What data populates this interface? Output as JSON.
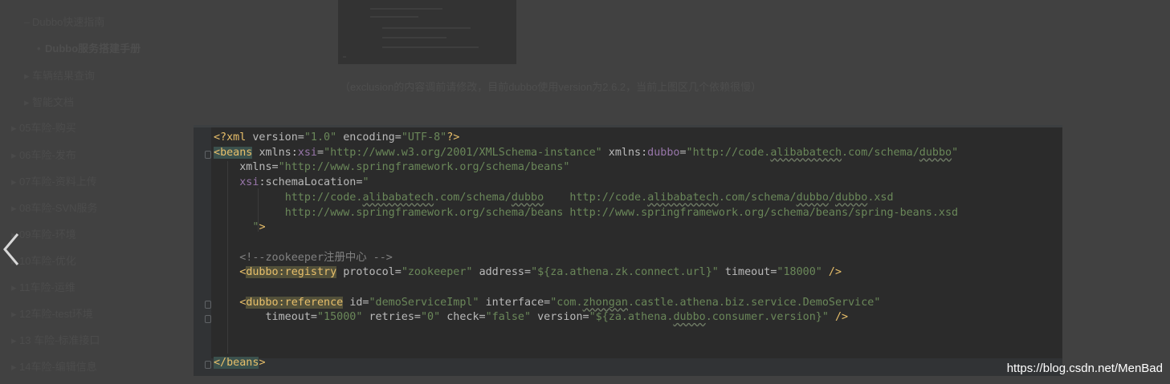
{
  "sidebar": {
    "items": [
      {
        "label": "Dubbo快速指南",
        "bold": false
      },
      {
        "label": "Dubbo服务搭建手册",
        "bold": true
      },
      {
        "label": "车辆结果查询",
        "bold": false
      },
      {
        "label": "智能文档",
        "bold": false
      },
      {
        "label": "05车险-购买",
        "bold": false
      },
      {
        "label": "06车险-发布",
        "bold": false
      },
      {
        "label": "07车险-资料上传",
        "bold": false
      },
      {
        "label": "08车险-SVN服务",
        "bold": false
      },
      {
        "label": "09车险-环境",
        "bold": false
      },
      {
        "label": "10车险-优化",
        "bold": false
      },
      {
        "label": "11车险-运维",
        "bold": false
      },
      {
        "label": "12车险-test环境",
        "bold": false
      },
      {
        "label": "13 车险-标准接口",
        "bold": false
      },
      {
        "label": "14车险-编辑信息",
        "bold": false
      }
    ]
  },
  "caption": "（exclusion的内容调前请修改，目前dubbo使用version为2.6.2，当前上图区几个依赖很慢）",
  "watermark": "https://blog.csdn.net/MenBad",
  "code": {
    "l1_pi_open": "<?xml",
    "l1_version_attr": "version=",
    "l1_version_val": "\"1.0\"",
    "l1_encoding_attr": "encoding=",
    "l1_encoding_val": "\"UTF-8\"",
    "l1_pi_close": "?>",
    "l2_tag": "beans",
    "l2_xmlns": "xmlns",
    "l2_xsi": "xsi",
    "l2_xsi_val": "\"http://www.w3.org/2001/XMLSchema-instance\"",
    "l2_dubbo": "dubbo",
    "l2_dubbo_val_a": "\"http://code.",
    "l2_dubbo_val_b": "alibabatech",
    "l2_dubbo_val_c": ".com/schema/",
    "l2_dubbo_val_d": "dubbo",
    "l2_dubbo_val_e": "\"",
    "l3_attr": "xmlns=",
    "l3_val": "\"http://www.springframework.org/schema/beans\"",
    "l4_ns": "xsi",
    "l4_attr": ":schemaLocation=",
    "l4_val": "\"",
    "l5_a": "http://code.",
    "l5_b": "alibabatech",
    "l5_c": ".com/schema/",
    "l5_d": "dubbo",
    "l5_e": "    http://code.",
    "l5_f": "alibabatech",
    "l5_g": ".com/schema/",
    "l5_h": "dubbo",
    "l5_i": "/",
    "l5_j": "dubbo",
    "l5_k": ".xsd",
    "l6": "http://www.springframework.org/schema/beans http://www.springframework.org/schema/beans/spring-beans.xsd",
    "l7_val": "\"",
    "l7_close": ">",
    "l9_comment": "<!--zookeeper注册中心 -->",
    "l10_open": "<",
    "l10_tag": "dubbo:registry",
    "l10_protocol": "protocol=",
    "l10_protocol_val": "\"zookeeper\"",
    "l10_address": "address=",
    "l10_address_val": "\"${za.athena.zk.connect.url}\"",
    "l10_timeout": "timeout=",
    "l10_timeout_val": "\"18000\"",
    "l10_close": "/>",
    "l12_open": "<",
    "l12_tag": "dubbo:reference",
    "l12_id": "id=",
    "l12_id_val": "\"demoServiceImpl\"",
    "l12_iface": "interface=",
    "l12_iface_val_a": "\"com.",
    "l12_iface_val_b": "zhongan",
    "l12_iface_val_c": ".castle.athena.biz.service.DemoService\"",
    "l13_timeout": "timeout=",
    "l13_timeout_val": "\"15000\"",
    "l13_retries": "retries=",
    "l13_retries_val": "\"0\"",
    "l13_check": "check=",
    "l13_check_val": "\"false\"",
    "l13_version": "version=",
    "l13_version_val_a": "\"${za.athena.",
    "l13_version_val_b": "dubbo",
    "l13_version_val_c": ".consumer.version}\"",
    "l13_close": "/>",
    "l16_open": "</",
    "l16_tag": "beans",
    "l16_close": ">"
  },
  "colors": {
    "editor_bg": "#2b2b2b",
    "tag": "#e8bf6a",
    "string": "#6a8759",
    "attribute": "#bababa",
    "namespace": "#9876aa",
    "comment": "#808080"
  }
}
